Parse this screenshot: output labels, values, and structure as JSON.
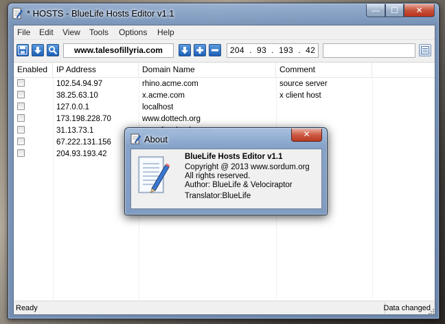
{
  "window": {
    "title": "* HOSTS - BlueLife Hosts Editor v1.1"
  },
  "menu": [
    "File",
    "Edit",
    "View",
    "Tools",
    "Options",
    "Help"
  ],
  "toolbar": {
    "domain_value": "www.talesofillyria.com",
    "ip_value": "204  .  93  .  193  .  42",
    "comment_value": ""
  },
  "table": {
    "headers": [
      "Enabled",
      "IP Address",
      "Domain Name",
      "Comment"
    ],
    "rows": [
      {
        "ip": "102.54.94.97",
        "domain": "rhino.acme.com",
        "comment": "source server"
      },
      {
        "ip": "38.25.63.10",
        "domain": "x.acme.com",
        "comment": "x client host"
      },
      {
        "ip": "127.0.0.1",
        "domain": "localhost",
        "comment": ""
      },
      {
        "ip": "173.198.228.70",
        "domain": "www.dottech.org",
        "comment": ""
      },
      {
        "ip": "31.13.73.1",
        "domain": "www.facebook.com",
        "comment": ""
      },
      {
        "ip": "67.222.131.156",
        "domain": "",
        "comment": ""
      },
      {
        "ip": "204.93.193.42",
        "domain": "",
        "comment": ""
      }
    ]
  },
  "status": {
    "left": "Ready",
    "right": "Data changed"
  },
  "about": {
    "title": "About",
    "close_glyph": "✕",
    "app_name": "BlueLife Hosts Editor v1.1",
    "copyright": "Copyright @ 2013 www.sordum.org",
    "rights": "All rights reserved.",
    "author": "Author: BlueLife & Velociraptor",
    "translator": "Translator:BlueLife"
  },
  "caption": {
    "min": "—",
    "max": "☐",
    "close": "✕"
  },
  "colors": {
    "accent": "#1d5fb6",
    "close_red": "#c7523b"
  }
}
